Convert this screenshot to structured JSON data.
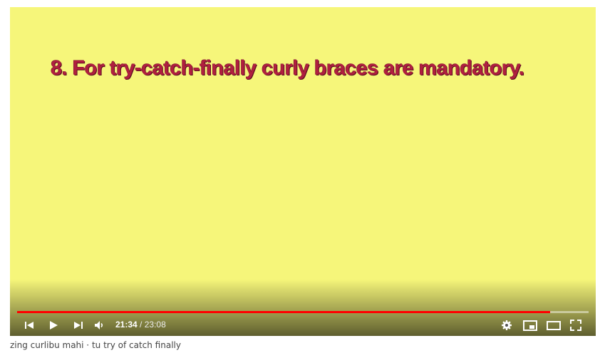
{
  "video": {
    "slide_text": "8. For try-catch-finally curly braces are mandatory.",
    "current_time": "21:34",
    "separator": " / ",
    "duration": "23:08",
    "progress": 0.9325,
    "progress_color": "#ff0000",
    "background_color": "#f6f67a"
  },
  "controls": {
    "left": [
      "previous-icon",
      "play-icon",
      "next-icon",
      "volume-icon"
    ],
    "right": [
      "settings-icon",
      "miniplayer-icon",
      "theater-mode-icon",
      "fullscreen-icon"
    ]
  },
  "below": {
    "caption": "zing curlibu mahi · tu try of catch finally"
  }
}
